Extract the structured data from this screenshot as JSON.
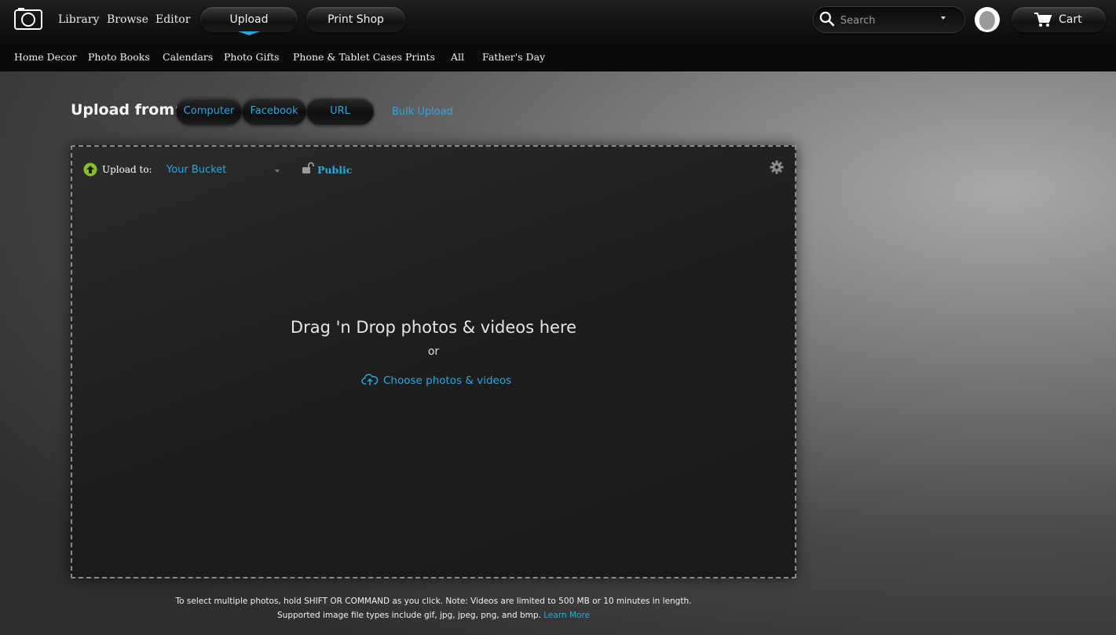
{
  "header": {
    "nav": [
      {
        "label": "Library"
      },
      {
        "label": "Browse"
      },
      {
        "label": "Editor"
      }
    ],
    "upload_tab": "Upload",
    "print_shop_tab": "Print Shop",
    "search_placeholder": "Search",
    "cart_label": "Cart"
  },
  "categories": [
    "Home Decor",
    "Photo Books",
    "Calendars",
    "Photo Gifts",
    "Phone & Tablet Cases",
    "Prints",
    "All",
    "Father's Day"
  ],
  "upload_from": {
    "label": "Upload from:",
    "sources": [
      "Computer",
      "Facebook",
      "URL"
    ],
    "bulk_upload": "Bulk Upload"
  },
  "dropzone": {
    "upload_to_label": "Upload to:",
    "bucket": "Your Bucket",
    "privacy": "Public",
    "drag_text": "Drag 'n Drop photos & videos here",
    "or_text": "or",
    "choose_text": "Choose photos & videos"
  },
  "footer": {
    "line1": "To select multiple photos, hold SHIFT OR COMMAND as you click. Note: Videos are limited to 500 MB or 10 minutes in length.",
    "line2": "Supported image file types include gif, jpg, jpeg, png, and bmp.",
    "learn_more": "Learn More"
  },
  "colors": {
    "accent": "#2aa7e0",
    "upload_icon": "#8bbf2a"
  }
}
